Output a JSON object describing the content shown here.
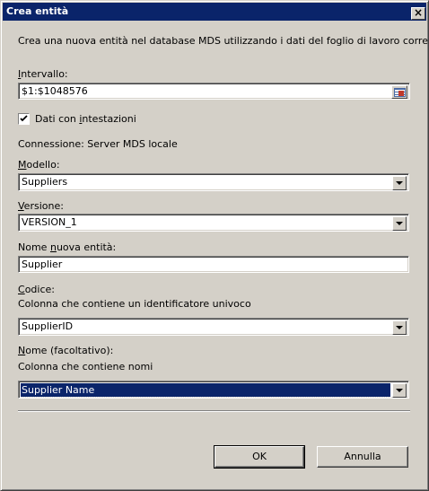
{
  "window": {
    "title": "Crea entità",
    "close_glyph": "×"
  },
  "description": "Crea una nuova entità nel database MDS utilizzando i dati del foglio di lavoro corrente.",
  "range": {
    "label_u": "I",
    "label_rest": "ntervallo:",
    "value": "$1:$1048576"
  },
  "headers_checkbox": {
    "checked": true,
    "label_pre": "Dati con ",
    "label_u": "i",
    "label_post": "ntestazioni"
  },
  "connection": "Connessione: Server MDS locale",
  "model": {
    "label_u": "M",
    "label_rest": "odello:",
    "value": "Suppliers"
  },
  "version": {
    "label_u": "V",
    "label_rest": "ersione:",
    "value": "VERSION_1"
  },
  "new_entity": {
    "label_pre": "Nome ",
    "label_u": "n",
    "label_post": "uova entità:",
    "value": "Supplier"
  },
  "code": {
    "label_u": "C",
    "label_rest": "odice:",
    "hint": "Colonna che contiene un identificatore univoco",
    "value": "SupplierID"
  },
  "name": {
    "label_u": "N",
    "label_rest": "ome (facoltativo):",
    "hint": "Colonna che contiene nomi",
    "value": "Supplier Name"
  },
  "buttons": {
    "ok": "OK",
    "cancel": "Annulla"
  },
  "colors": {
    "titlebar": "#0a246a",
    "face": "#d4d0c8",
    "selection": "#0a246a"
  },
  "icons": [
    "close-icon",
    "range-select-icon",
    "dropdown-arrow-icon",
    "checkmark-icon"
  ]
}
